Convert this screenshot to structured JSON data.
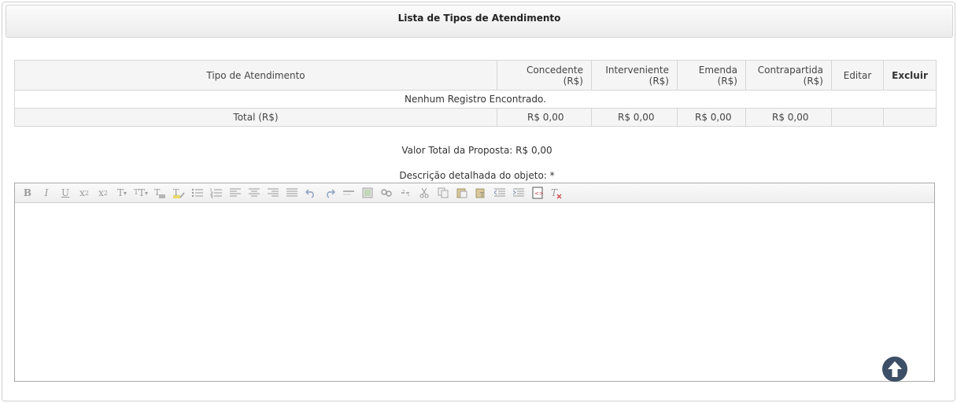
{
  "panel": {
    "title": "Lista de Tipos de Atendimento"
  },
  "table": {
    "headers": {
      "tipo": "Tipo de Atendimento",
      "concedente": "Concedente (R$)",
      "interveniente_l1": "Interveniente",
      "interveniente_l2": "(R$)",
      "emenda_l1": "Emenda",
      "emenda_l2": "(R$)",
      "contrapartida_l1": "Contrapartida",
      "contrapartida_l2": "(R$)",
      "editar": "Editar",
      "excluir": "Excluir"
    },
    "empty_message": "Nenhum Registro Encontrado.",
    "total": {
      "label": "Total (R$)",
      "concedente": "R$ 0,00",
      "interveniente": "R$ 0,00",
      "emenda": "R$ 0,00",
      "contrapartida": "R$ 0,00"
    }
  },
  "summary": {
    "valor_total": "Valor Total da Proposta: R$ 0,00"
  },
  "description": {
    "label": "Descrição detalhada do objeto: *"
  },
  "editor": {
    "toolbar": [
      "bold-icon",
      "italic-icon",
      "underline-icon",
      "subscript-icon",
      "superscript-icon",
      "font-family-icon",
      "font-size-icon",
      "font-color-icon",
      "highlight-icon",
      "bullet-list-icon",
      "numbered-list-icon",
      "align-left-icon",
      "align-center-icon",
      "align-right-icon",
      "justify-icon",
      "undo-icon",
      "redo-icon",
      "horizontal-rule-icon",
      "image-icon",
      "link-icon",
      "unlink-icon",
      "cut-icon",
      "copy-icon",
      "paste-icon",
      "paste-text-icon",
      "outdent-icon",
      "indent-icon",
      "source-code-icon",
      "clear-format-icon"
    ]
  },
  "colors": {
    "scroll_button": "#3d4f66",
    "header_gradient_top": "#fbfbfb",
    "header_gradient_bottom": "#ececec"
  }
}
